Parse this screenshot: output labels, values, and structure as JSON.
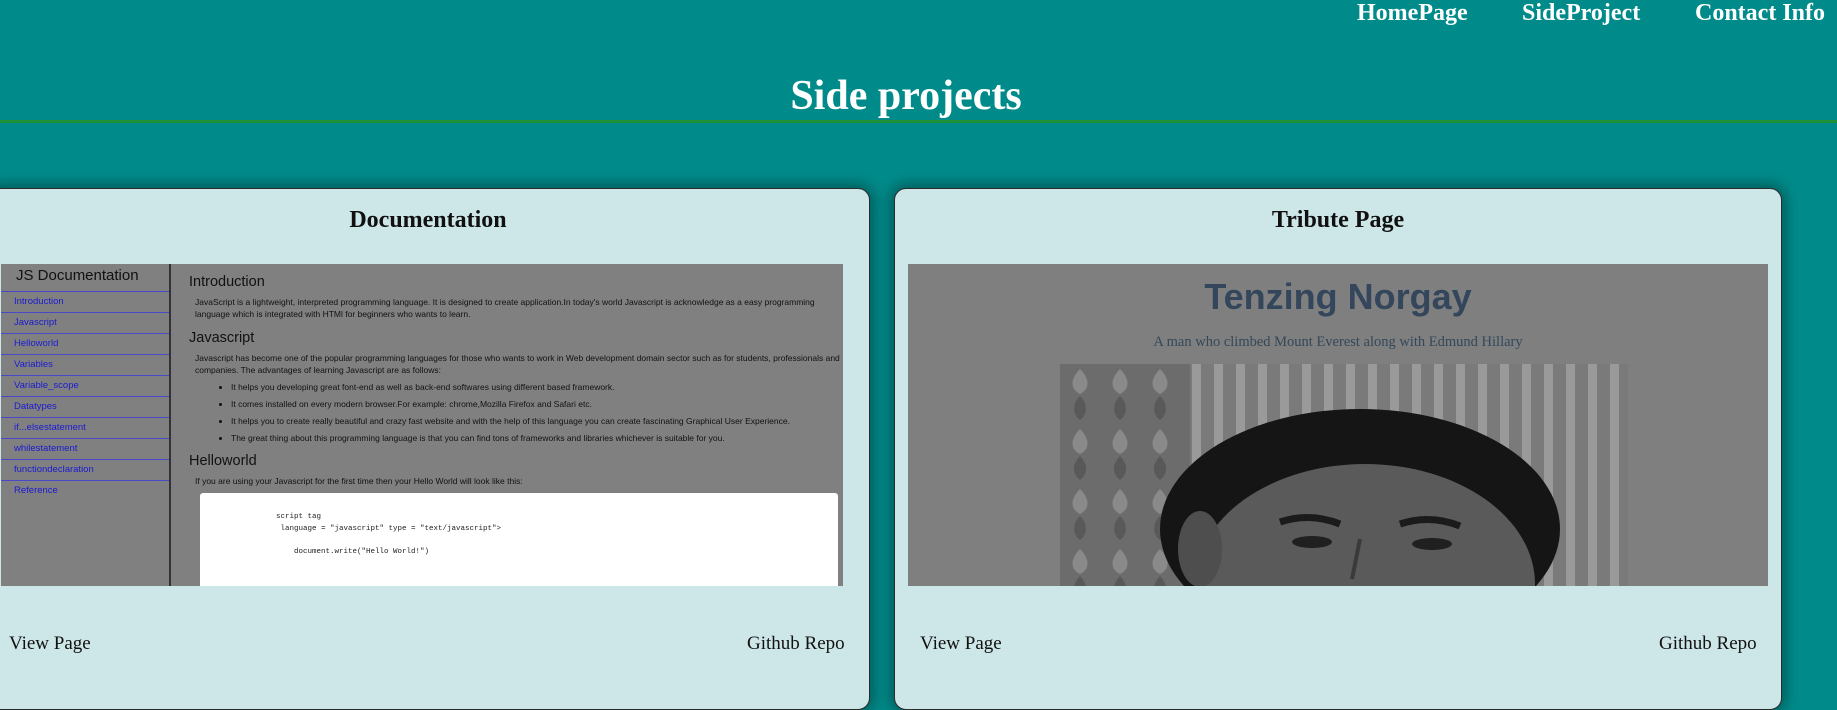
{
  "nav": {
    "home": "HomePage",
    "side": "SideProject",
    "contact": "Contact Info"
  },
  "page_title": "Side projects",
  "cards": [
    {
      "title": "Documentation",
      "view_label": "View Page",
      "repo_label": "Github Repo",
      "preview": {
        "sidebar_title": "JS Documentation",
        "sidebar_items": [
          "Introduction",
          "Javascript",
          "Helloworld",
          "Variables",
          "Variable_scope",
          "Datatypes",
          "if...elsestatement",
          "whilestatement",
          "functiondeclaration",
          "Reference"
        ],
        "sections": {
          "intro_heading": "Introduction",
          "intro_text": "JavaScript is a lightweight, interpreted programming language. It is designed to create application.In today's world Javascript is acknowledge as a easy programming language which is integrated with HTMl for beginners who wants to learn.",
          "js_heading": "Javascript",
          "js_text": "Javascript has become one of the popular programming languages for those who wants to work in Web development domain sector such as for students, professionals and companies. The advantages of learning Javascript are as follows:",
          "js_bullets": [
            "It helps you developing great font-end as well as back-end softwares using different based framework.",
            "It comes installed on every modern browser.For example: chrome,Mozilla Firefox and Safari etc.",
            "It helps you to create really beautiful and crazy fast website and with the help of this language you can create fascinating Graphical User Experience.",
            "The great thing about this programming language is that you can find tons of frameworks and libraries whichever is suitable for you."
          ],
          "hello_heading": "Helloworld",
          "hello_text": "If you are using your Javascript for the first time then your Hello World will look like this:",
          "code_lines": [
            "script tag",
            " language = \"javascript\" type = \"text/javascript\">",
            "",
            "    document.write(\"Hello World!\")"
          ]
        }
      }
    },
    {
      "title": "Tribute Page",
      "view_label": "View Page",
      "repo_label": "Github Repo",
      "preview": {
        "heading": "Tenzing Norgay",
        "subheading": "A man who climbed Mount Everest along with Edmund Hillary"
      }
    }
  ],
  "colors": {
    "background": "#008b8a",
    "card": "#cde7e8",
    "rule": "#1f8f3a",
    "preview_gray": "#808080"
  }
}
